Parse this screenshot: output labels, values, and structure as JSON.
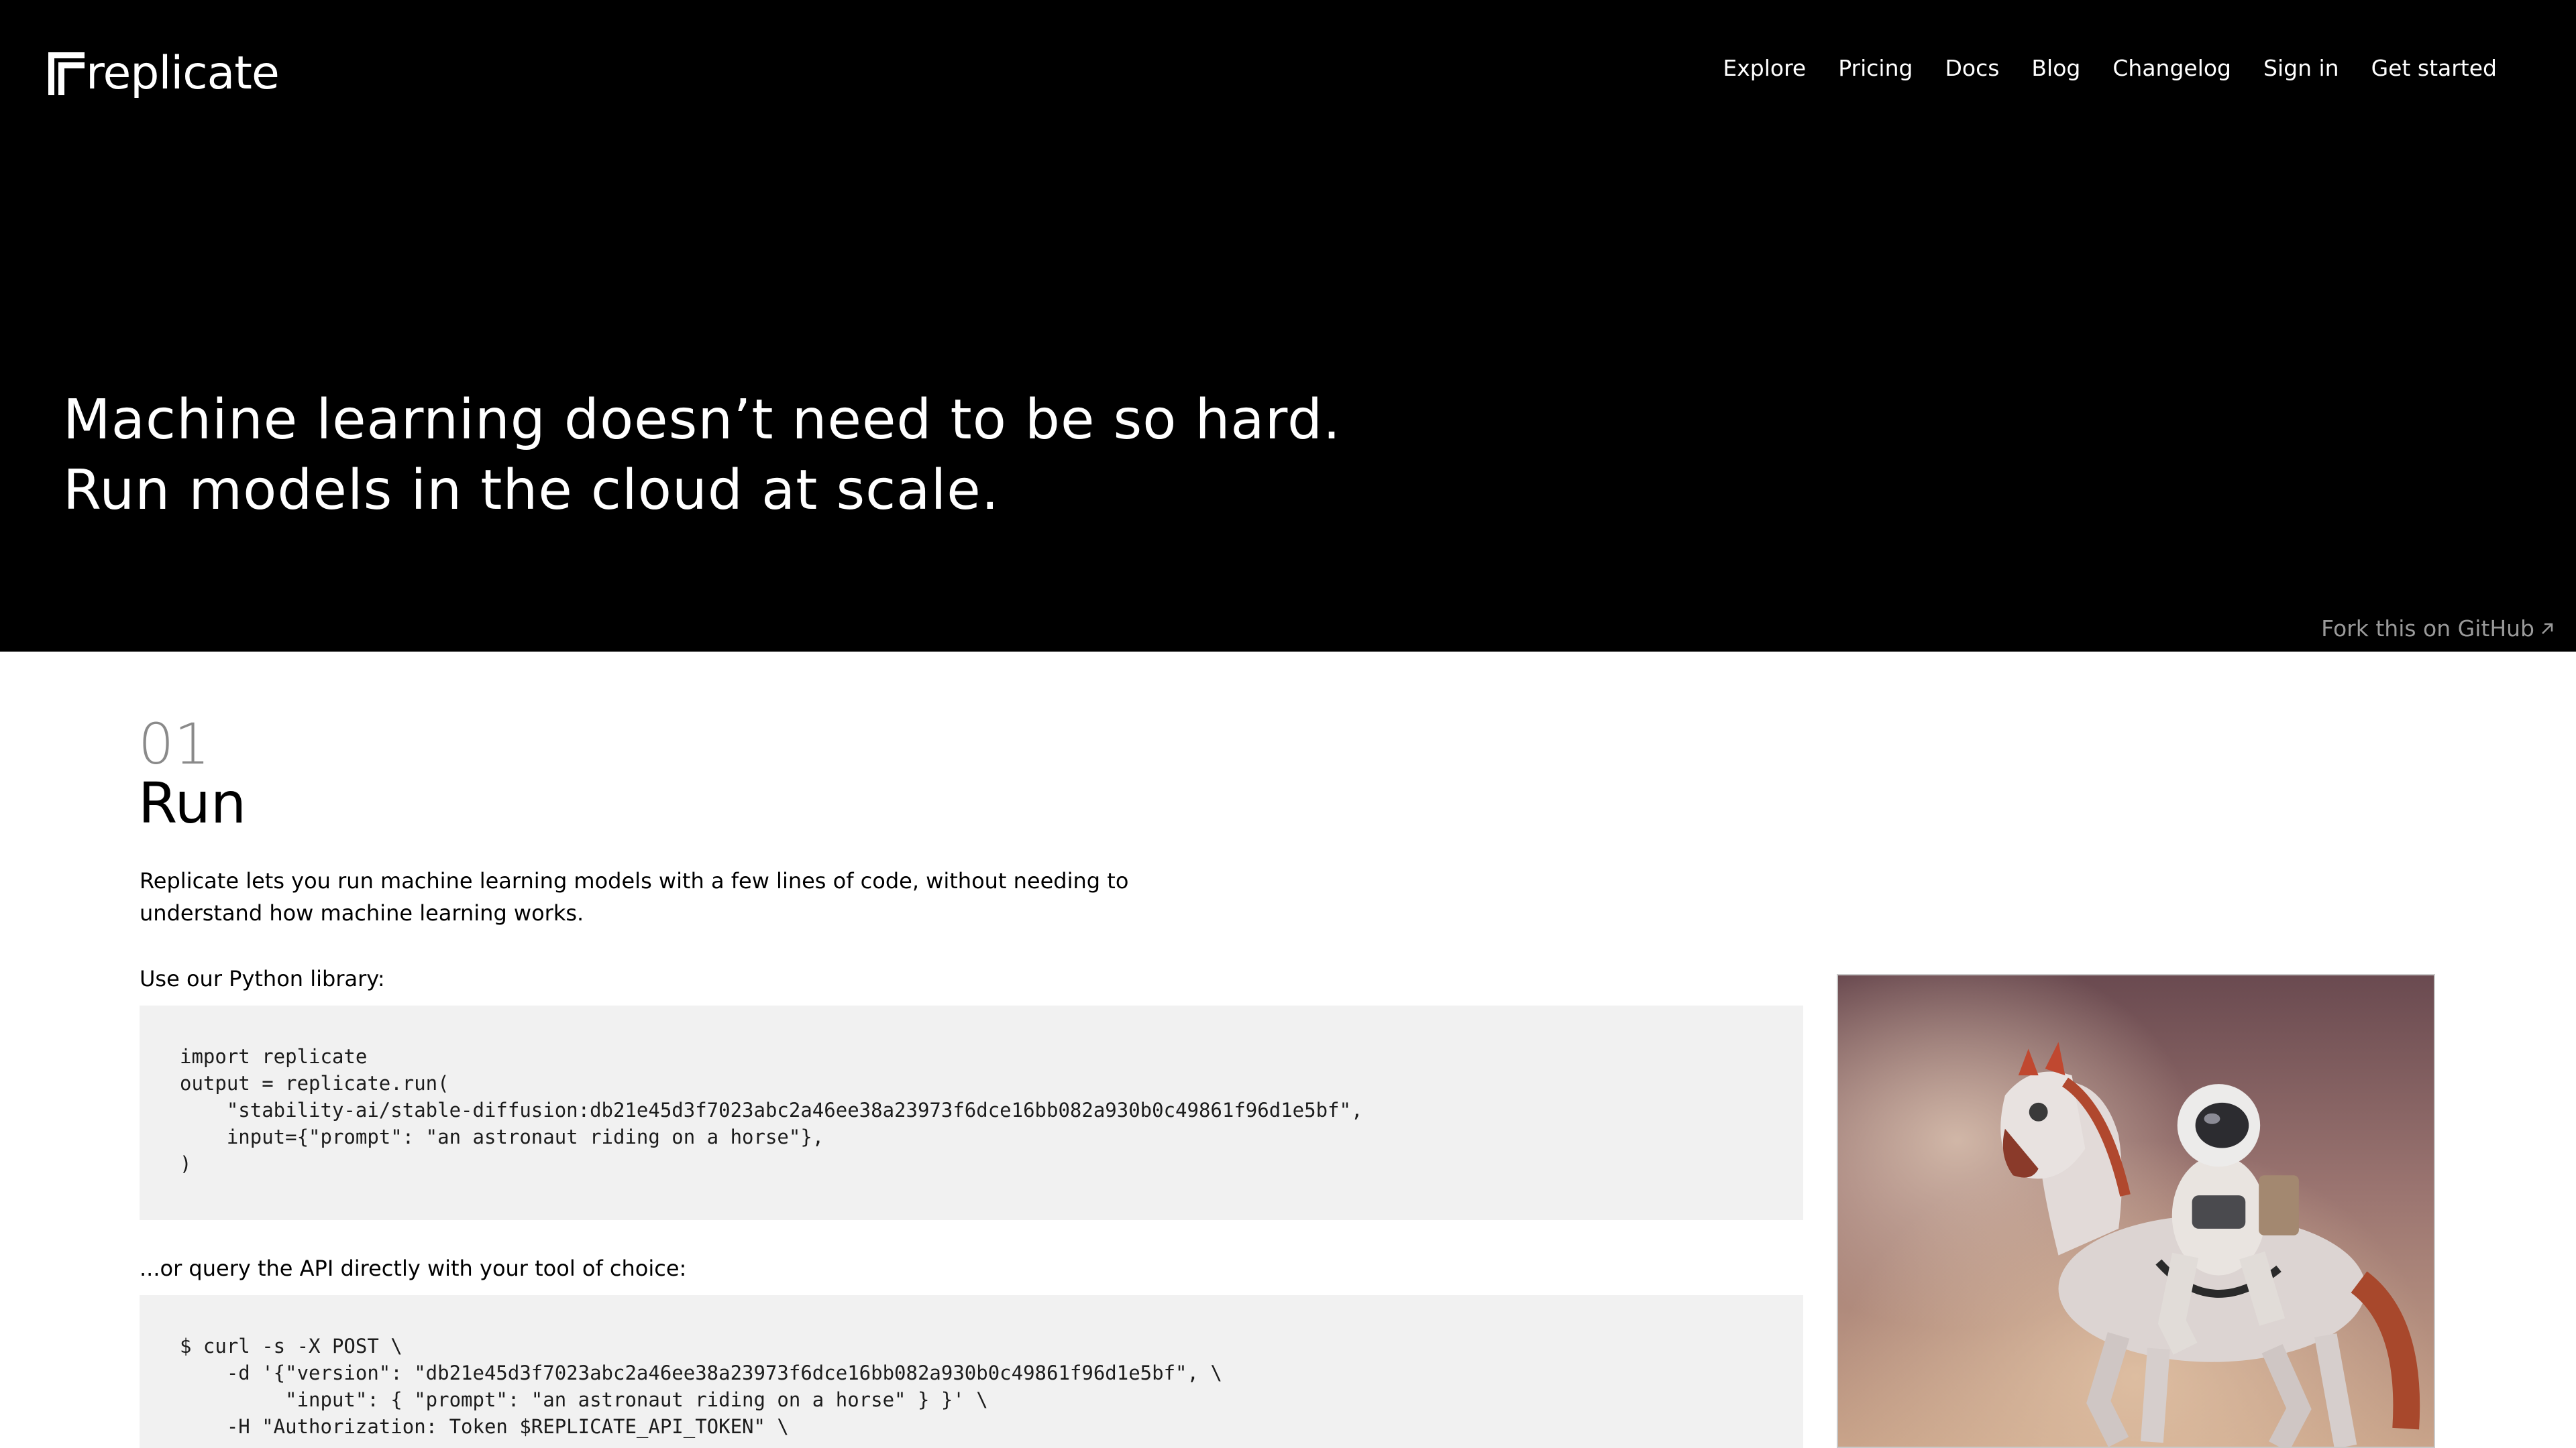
{
  "header": {
    "logo_text": "replicate",
    "nav": [
      {
        "label": "Explore"
      },
      {
        "label": "Pricing"
      },
      {
        "label": "Docs"
      },
      {
        "label": "Blog"
      },
      {
        "label": "Changelog"
      },
      {
        "label": "Sign in"
      },
      {
        "label": "Get started"
      }
    ]
  },
  "hero": {
    "headline_line1": "Machine learning doesn’t need to be so hard.",
    "headline_line2": "Run models in the cloud at scale.",
    "fork_label": "Fork this on GitHub"
  },
  "run_section": {
    "number": "01",
    "title": "Run",
    "intro": "Replicate lets you run machine learning models with a few lines of code, without needing to understand how machine learning works.",
    "python_label": "Use our Python library:",
    "python_code": "import replicate\noutput = replicate.run(\n    \"stability-ai/stable-diffusion:db21e45d3f7023abc2a46ee38a23973f6dce16bb082a930b0c49861f96d1e5bf\",\n    input={\"prompt\": \"an astronaut riding on a horse\"},\n)",
    "api_label": "...or query the API directly with your tool of choice:",
    "curl_code": "$ curl -s -X POST \\\n    -d '{\"version\": \"db21e45d3f7023abc2a46ee38a23973f6dce16bb082a930b0c49861f96d1e5bf\", \\\n         \"input\": { \"prompt\": \"an astronaut riding on a horse\" } }' \\\n    -H \"Authorization: Token $REPLICATE_API_TOKEN\" \\",
    "example_image": "astronaut-riding-horse-image"
  },
  "colors": {
    "hero_bg": "#000000",
    "code_bg": "#f1f1f1",
    "muted_text": "#8a8a8a"
  }
}
